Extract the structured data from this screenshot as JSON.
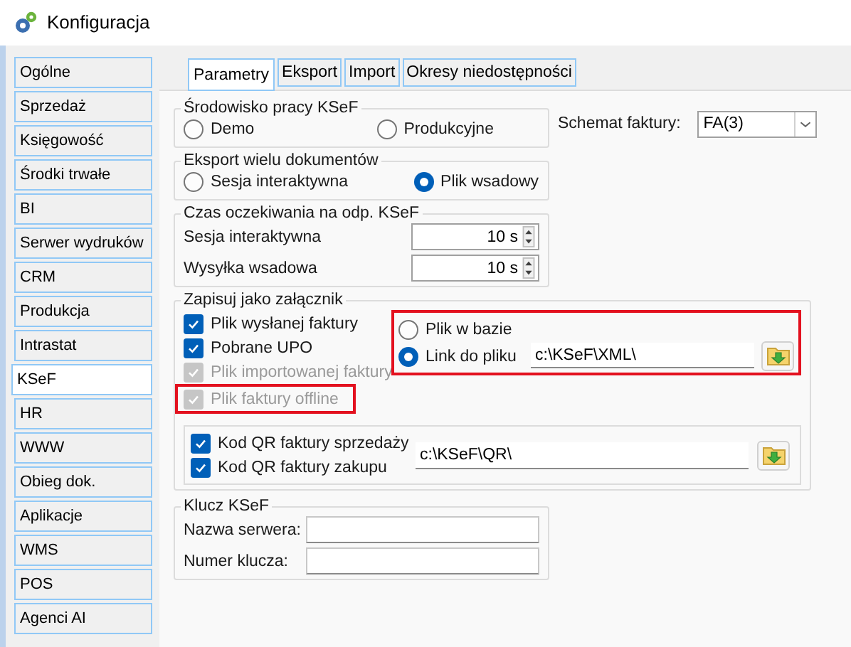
{
  "window": {
    "title": "Konfiguracja"
  },
  "sidebar": {
    "items": [
      {
        "label": "Ogólne",
        "selected": false
      },
      {
        "label": "Sprzedaż",
        "selected": false
      },
      {
        "label": "Księgowość",
        "selected": false
      },
      {
        "label": "Środki trwałe",
        "selected": false
      },
      {
        "label": "BI",
        "selected": false
      },
      {
        "label": "Serwer wydruków",
        "selected": false
      },
      {
        "label": "CRM",
        "selected": false
      },
      {
        "label": "Produkcja",
        "selected": false
      },
      {
        "label": "Intrastat",
        "selected": false
      },
      {
        "label": "KSeF",
        "selected": true
      },
      {
        "label": "HR",
        "selected": false
      },
      {
        "label": "WWW",
        "selected": false
      },
      {
        "label": "Obieg dok.",
        "selected": false
      },
      {
        "label": "Aplikacje",
        "selected": false
      },
      {
        "label": "WMS",
        "selected": false
      },
      {
        "label": "POS",
        "selected": false
      },
      {
        "label": "Agenci AI",
        "selected": false
      }
    ]
  },
  "tabs": [
    {
      "label": "Parametry",
      "selected": true
    },
    {
      "label": "Eksport",
      "selected": false
    },
    {
      "label": "Import",
      "selected": false
    },
    {
      "label": "Okresy niedostępności",
      "selected": false
    }
  ],
  "environment": {
    "title": "Środowisko pracy KSeF",
    "options": [
      {
        "label": "Demo",
        "selected": false
      },
      {
        "label": "Produkcyjne",
        "selected": false
      }
    ]
  },
  "invoice_schema": {
    "label": "Schemat faktury:",
    "value": "FA(3)"
  },
  "bulk_export": {
    "title": "Eksport wielu dokumentów",
    "options": [
      {
        "label": "Sesja interaktywna",
        "selected": false
      },
      {
        "label": "Plik wsadowy",
        "selected": true
      }
    ]
  },
  "timeouts": {
    "title": "Czas oczekiwania na odp. KSeF",
    "rows": [
      {
        "label": "Sesja interaktywna",
        "value": "10 s"
      },
      {
        "label": "Wysyłka wsadowa",
        "value": "10 s"
      }
    ]
  },
  "attachment": {
    "title": "Zapisuj jako załącznik",
    "checkboxes": [
      {
        "label": "Plik wysłanej faktury",
        "checked": true,
        "disabled": false,
        "highlighted": false
      },
      {
        "label": "Pobrane UPO",
        "checked": true,
        "disabled": false,
        "highlighted": false
      },
      {
        "label": "Plik importowanej faktury",
        "checked": true,
        "disabled": true,
        "highlighted": false
      },
      {
        "label": "Plik faktury offline",
        "checked": true,
        "disabled": true,
        "highlighted": true
      }
    ],
    "storage": {
      "highlighted": true,
      "options": [
        {
          "label": "Plik w bazie",
          "selected": false
        },
        {
          "label": "Link do pliku",
          "selected": true
        }
      ],
      "path": "c:\\KSeF\\XML\\"
    },
    "qr": {
      "checkboxes": [
        {
          "label": "Kod QR faktury sprzedaży",
          "checked": true,
          "disabled": false,
          "highlighted": false
        },
        {
          "label": "Kod QR faktury zakupu",
          "checked": true,
          "disabled": false,
          "highlighted": false
        }
      ],
      "path": "c:\\KSeF\\QR\\"
    }
  },
  "key": {
    "title": "Klucz KSeF",
    "fields": [
      {
        "label": "Nazwa serwera:"
      },
      {
        "label": "Numer klucza:"
      }
    ]
  }
}
